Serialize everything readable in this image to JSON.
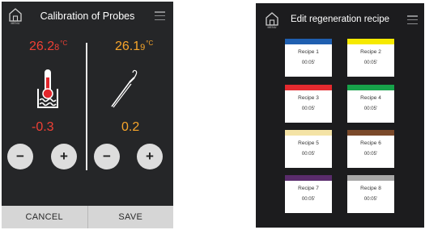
{
  "calibration": {
    "title": "Calibration of Probes",
    "menu_label": "MENU",
    "left_probe": {
      "temp_value": "26.2",
      "temp_digit": "8",
      "temp_unit": "°C",
      "offset": "-0.3",
      "color": "#f04035",
      "icon": "thermometer-water-icon"
    },
    "right_probe": {
      "temp_value": "26.1",
      "temp_digit": "9",
      "temp_unit": "°C",
      "offset": "0.2",
      "color": "#f7a52b",
      "icon": "core-probe-icon"
    },
    "minus_label": "−",
    "plus_label": "+",
    "cancel_label": "CANCEL",
    "save_label": "SAVE"
  },
  "regeneration": {
    "title": "Edit regeneration recipe",
    "menu_label": "MENU",
    "recipes": [
      {
        "name": "Recipe 1",
        "time": "00:05'",
        "color": "#1f5fb0"
      },
      {
        "name": "Recipe 2",
        "time": "00:05'",
        "color": "#f6e900"
      },
      {
        "name": "Recipe 3",
        "time": "00:05'",
        "color": "#e42a2f"
      },
      {
        "name": "Recipe 4",
        "time": "00:05'",
        "color": "#17a24a"
      },
      {
        "name": "Recipe 5",
        "time": "00:05'",
        "color": "#f4e3a6"
      },
      {
        "name": "Recipe 6",
        "time": "00:05'",
        "color": "#7b4a2a"
      },
      {
        "name": "Recipe 7",
        "time": "00:05'",
        "color": "#5a2c6c"
      },
      {
        "name": "Recipe 8",
        "time": "00:05'",
        "color": "#a8a8a8"
      }
    ]
  }
}
